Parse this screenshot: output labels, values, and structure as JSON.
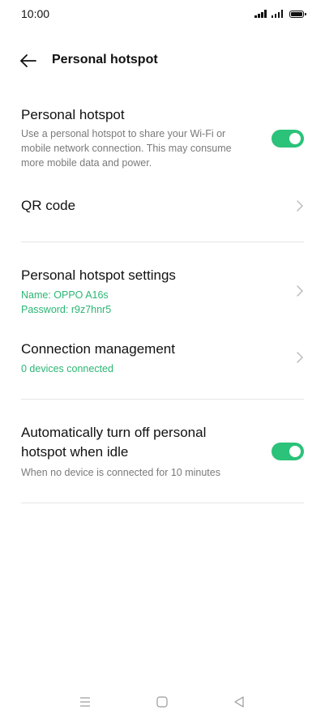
{
  "status_bar": {
    "time": "10:00"
  },
  "header": {
    "title": "Personal hotspot",
    "back_icon": "back-arrow-icon"
  },
  "hotspot": {
    "title": "Personal hotspot",
    "description": "Use a personal hotspot to share your Wi-Fi or mobile network connection. This may consume more mobile data and power.",
    "enabled": true
  },
  "qr_code": {
    "title": "QR code"
  },
  "settings": {
    "title": "Personal hotspot settings",
    "name_line": "Name: OPPO A16s",
    "password_line": "Password: r9z7hnr5"
  },
  "connection": {
    "title": "Connection management",
    "status": "0 devices connected"
  },
  "auto_off": {
    "title": "Automatically turn off personal hotspot when idle",
    "description": "When no device is connected for 10 minutes",
    "enabled": true
  },
  "colors": {
    "accent": "#2bc279",
    "accent_text": "#2bb673",
    "secondary_text": "#7a7a7a",
    "divider": "#e6e6e6"
  },
  "nav": {
    "icons": [
      "menu-icon",
      "home-square-icon",
      "back-triangle-icon"
    ]
  }
}
